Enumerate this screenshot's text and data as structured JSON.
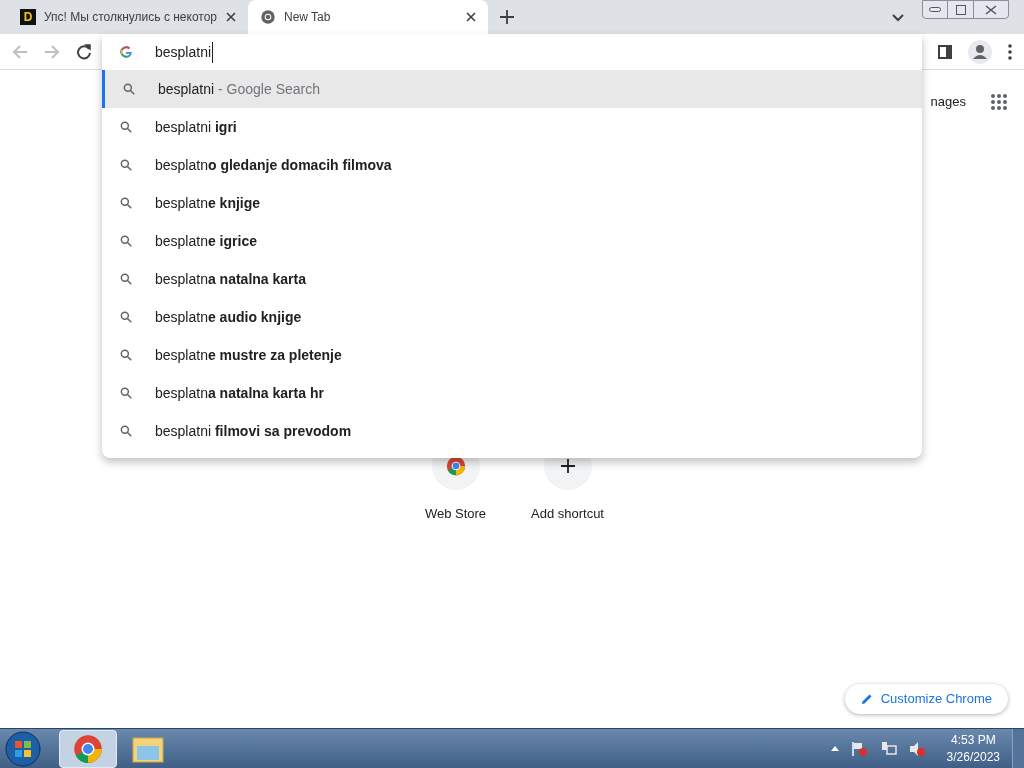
{
  "tabs": [
    {
      "title": "Упс! Мы столкнулись с некотор",
      "selected": false,
      "kind": "site",
      "favicon": "D"
    },
    {
      "title": "New Tab",
      "selected": true,
      "kind": "chrome"
    }
  ],
  "omnibox": {
    "value": "besplatni"
  },
  "suggestions": [
    {
      "text": "besplatni",
      "hint": "- Google Search",
      "selected": true
    },
    {
      "text": "besplatni **igri**",
      "selected": false
    },
    {
      "text": "besplatn**o gledanje domacih filmova**",
      "selected": false
    },
    {
      "text": "besplatn**e knjige**",
      "selected": false
    },
    {
      "text": "besplatn**e igrice**",
      "selected": false
    },
    {
      "text": "besplatn**a natalna karta**",
      "selected": false
    },
    {
      "text": "besplatn**e audio knjige**",
      "selected": false
    },
    {
      "text": "besplatn**e mustre za pletenje**",
      "selected": false
    },
    {
      "text": "besplatn**a natalna karta hr**",
      "selected": false
    },
    {
      "text": "besplatni **filmovi sa prevodom**",
      "selected": false
    }
  ],
  "header_link": "nages",
  "shortcuts": [
    {
      "label": "Web Store",
      "kind": "store"
    },
    {
      "label": "Add shortcut",
      "kind": "add"
    }
  ],
  "customize_button": "Customize Chrome",
  "taskbar": {
    "time": "4:53 PM",
    "date": "3/26/2023"
  }
}
